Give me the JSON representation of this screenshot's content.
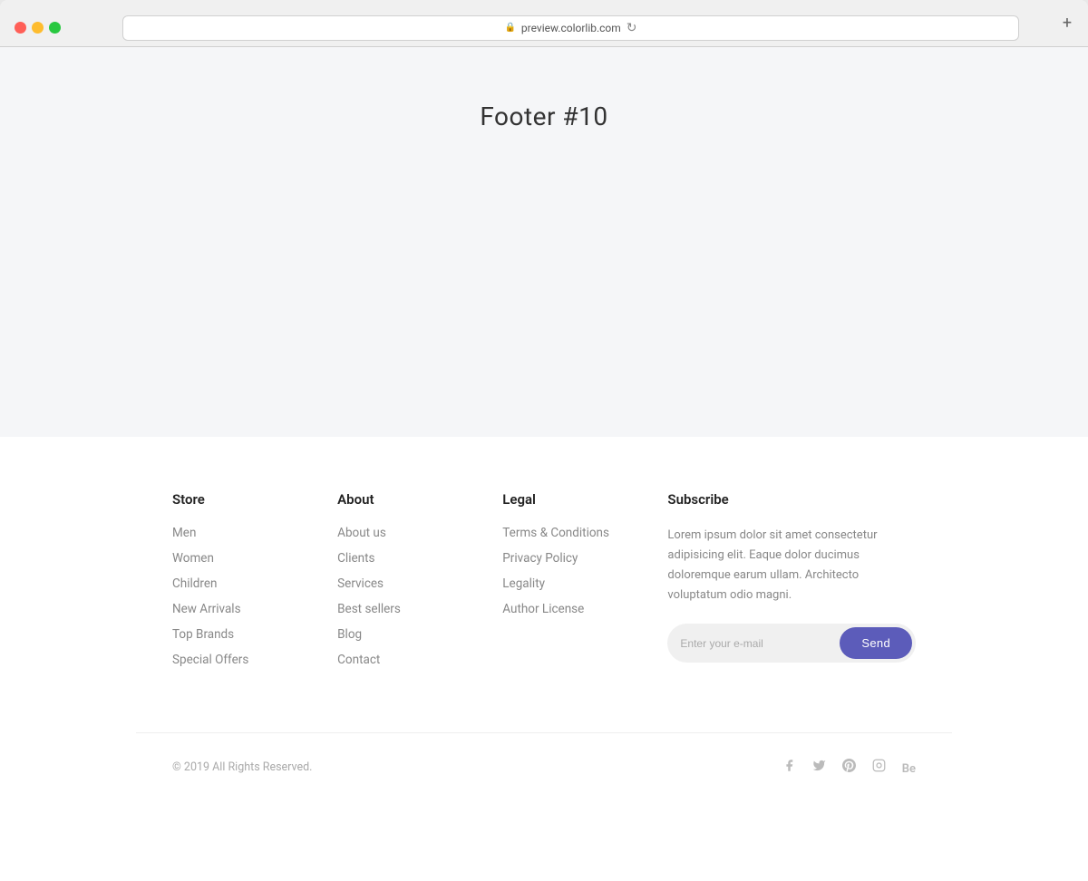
{
  "browser": {
    "url": "preview.colorlib.com",
    "new_tab_label": "+"
  },
  "page": {
    "title": "Footer #10"
  },
  "footer": {
    "store": {
      "heading": "Store",
      "links": [
        "Men",
        "Women",
        "Children",
        "New Arrivals",
        "Top Brands",
        "Special Offers"
      ]
    },
    "about": {
      "heading": "About",
      "links": [
        "About us",
        "Clients",
        "Services",
        "Best sellers",
        "Blog",
        "Contact"
      ]
    },
    "legal": {
      "heading": "Legal",
      "links": [
        "Terms & Conditions",
        "Privacy Policy",
        "Legality",
        "Author License"
      ]
    },
    "subscribe": {
      "heading": "Subscribe",
      "description": "Lorem ipsum dolor sit amet consectetur adipisicing elit. Eaque dolor ducimus doloremque earum ullam. Architecto voluptatum odio magni.",
      "email_placeholder": "Enter your e-mail",
      "send_label": "Send"
    },
    "bottom": {
      "copyright": "© 2019 All Rights Reserved."
    }
  }
}
